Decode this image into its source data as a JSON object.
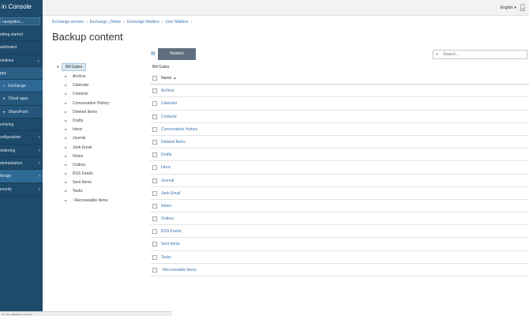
{
  "sidebar": {
    "brand": "in Console",
    "search_placeholder": "navigation...",
    "items": [
      {
        "label": "etting started",
        "chevron": ""
      },
      {
        "label": "ashboard",
        "chevron": ""
      },
      {
        "label": "olutions",
        "chevron": "⌄"
      },
      {
        "label": "pps",
        "chevron": ""
      },
      {
        "label": "Exchange",
        "chevron": "",
        "icon": "▪"
      },
      {
        "label": "Cloud apps",
        "chevron": "",
        "icon": "▸"
      },
      {
        "label": "SharePoint",
        "chevron": "",
        "icon": "▸"
      },
      {
        "label": "rchiving",
        "chevron": ""
      },
      {
        "label": "onfiguration",
        "chevron": "›"
      },
      {
        "label": "onitoring",
        "chevron": "›"
      },
      {
        "label": "dministration",
        "chevron": "›"
      },
      {
        "label": "torage",
        "chevron": "›"
      },
      {
        "label": "ecurity",
        "chevron": "›"
      }
    ]
  },
  "topbar": {
    "language": "English ▾",
    "user_icon": "user-icon"
  },
  "breadcrumb": [
    "Exchange servers",
    "Exchange_Online",
    "Exchange Mailbox",
    "User Mailbox"
  ],
  "page_title": "Backup content",
  "tree": {
    "root": "Bill Gates",
    "items": [
      "Archive",
      "Calendar",
      "Contacts",
      "Conversation History",
      "Deleted Items",
      "Drafts",
      "Inbox",
      "Journal",
      "Junk Email",
      "Notes",
      "Outbox",
      "RSS Feeds",
      "Sent Items",
      "Tasks",
      "~Recoverable Items"
    ]
  },
  "toolbar": {
    "restore_label": "Restore",
    "search_placeholder": "Search..."
  },
  "table": {
    "caption": "Bill Gates",
    "column_name": "Name",
    "rows": [
      "Archive",
      "Calendar",
      "Contacts",
      "Conversation History",
      "Deleted Items",
      "Drafts",
      "Inbox",
      "Journal",
      "Junk Email",
      "Notes",
      "Outbox",
      "RSS Feeds",
      "Sent Items",
      "Tasks",
      "~Recoverable Items"
    ]
  },
  "statusbar": {
    "text": "10.1.111.188/admin-console/..."
  }
}
